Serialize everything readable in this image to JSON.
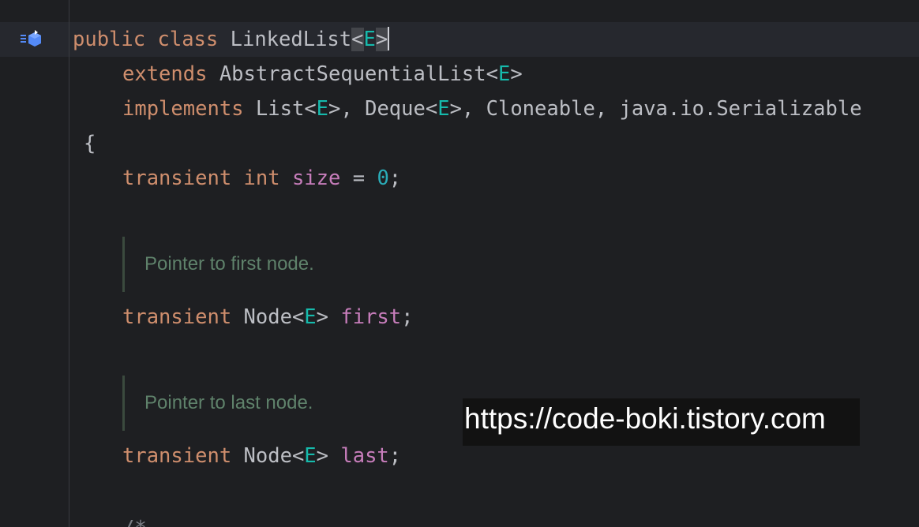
{
  "gutter": {
    "icon": "implementation-arrow-icon",
    "icon_color": "#548af7"
  },
  "code": {
    "line1": {
      "kw_public": "public",
      "kw_class": "class",
      "class_name": "LinkedList",
      "lt": "<",
      "type_param": "E",
      "gt": ">"
    },
    "line2": {
      "kw_extends": "extends",
      "super_name": "AbstractSequentialList",
      "lt": "<",
      "type_param": "E",
      "gt": ">"
    },
    "line3": {
      "kw_implements": "implements",
      "list": "List",
      "type_param1": "E",
      "sep1": ">, Deque<",
      "type_param2": "E",
      "rest": ">, Cloneable, java.io.Serializable",
      "lt": "<"
    },
    "line4": {
      "brace": "{"
    },
    "line5": {
      "kw_transient": "transient",
      "kw_int": "int",
      "field": "size",
      "eq": " = ",
      "num": "0",
      "semi": ";"
    },
    "doc1": "Pointer to first node.",
    "line6": {
      "kw_transient": "transient",
      "type": "Node<",
      "type_param": "E",
      "gt": "> ",
      "field": "first",
      "semi": ";"
    },
    "doc2": "Pointer to last node.",
    "line7": {
      "kw_transient": "transient",
      "type": "Node<",
      "type_param": "E",
      "gt": "> ",
      "field": "last",
      "semi": ";"
    },
    "cut_line": "/*"
  },
  "watermark": "https://code-boki.tistory.com",
  "colors": {
    "background": "#1e1f22",
    "keyword": "#cf8e6d",
    "type_param": "#16baac",
    "field": "#c77dbb",
    "number": "#2aacb8",
    "plain": "#bcbec4",
    "doc": "#5f826b"
  }
}
